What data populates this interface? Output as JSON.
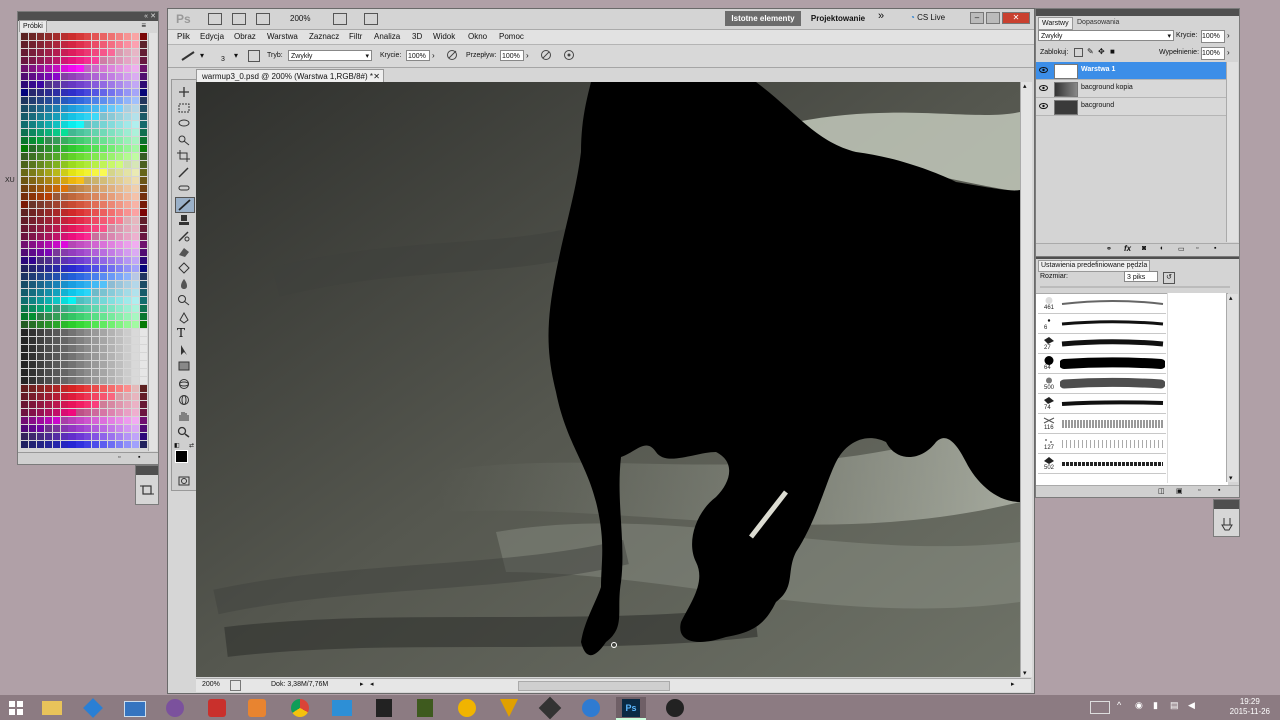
{
  "swatches": {
    "tab_label": "Próbki",
    "side_label": "XU"
  },
  "app": {
    "logo": "Ps",
    "zoom": "200%",
    "workspace_active": "Istotne elementy",
    "workspace_other": "Projektowanie",
    "more": "»",
    "cslive": "CS Live"
  },
  "menu": [
    "Plik",
    "Edycja",
    "Obraz",
    "Warstwa",
    "Zaznacz",
    "Filtr",
    "Analiza",
    "3D",
    "Widok",
    "Okno",
    "Pomoc"
  ],
  "options": {
    "brush_size": "3",
    "mode_label": "Tryb:",
    "mode_value": "Zwykły",
    "opacity_label": "Krycie:",
    "opacity_value": "100%",
    "flow_label": "Przepływ:",
    "flow_value": "100%"
  },
  "document": {
    "tab_title": "warmup3_0.psd @ 200% (Warstwa 1,RGB/8#) *",
    "status_zoom": "200%",
    "status_doc": "Dok: 3,38M/7,76M"
  },
  "layers": {
    "tab_active": "Warstwy",
    "tab_other": "Dopasowania",
    "blend_mode": "Zwykły",
    "opacity_label": "Krycie:",
    "opacity_value": "100%",
    "lock_label": "Zablokuj:",
    "fill_label": "Wypełnienie:",
    "fill_value": "100%",
    "items": [
      {
        "name": "Warstwa 1",
        "selected": true
      },
      {
        "name": "bacground kopia",
        "selected": false
      },
      {
        "name": "bacground",
        "selected": false
      }
    ]
  },
  "brushes": {
    "title": "Ustawienia predefiniowane pędzla",
    "size_label": "Rozmiar:",
    "size_value": "3 piks",
    "items": [
      {
        "size": "461"
      },
      {
        "size": "6"
      },
      {
        "size": "27"
      },
      {
        "size": "64"
      },
      {
        "size": "500"
      },
      {
        "size": "74"
      },
      {
        "size": "116"
      },
      {
        "size": "127"
      },
      {
        "size": "502"
      }
    ]
  },
  "taskbar": {
    "time": "19:29",
    "date": "2015-11-26"
  },
  "colors": {
    "desktop": "#b0a0a7",
    "selection": "#3c8ee8",
    "taskbar": "#8c7b82"
  }
}
